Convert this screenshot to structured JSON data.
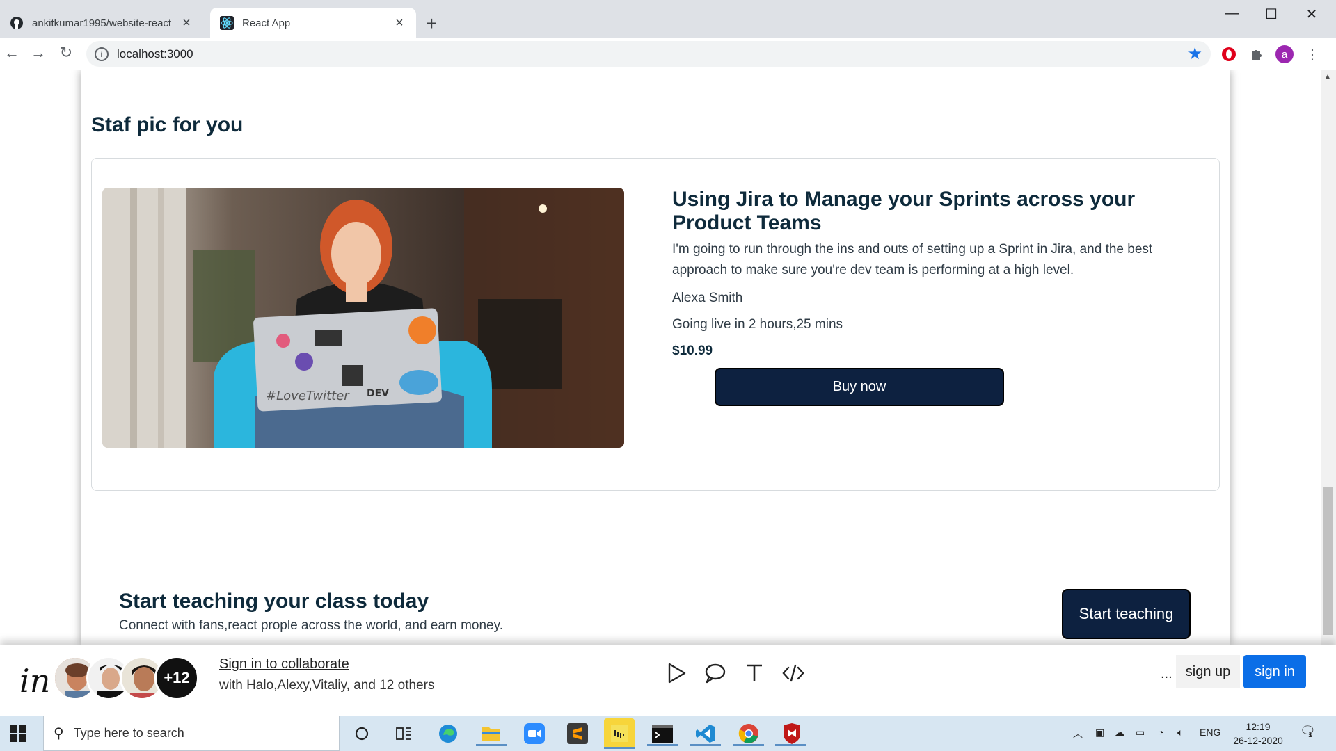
{
  "browser": {
    "tabs": [
      {
        "title": "ankitkumar1995/website-react",
        "active": false,
        "icon": "github-icon"
      },
      {
        "title": "React App",
        "active": true,
        "icon": "react-icon"
      }
    ],
    "url": "localhost:3000"
  },
  "page": {
    "section_title": "Staf pic for you",
    "card": {
      "title": "Using Jira to Manage your Sprints across your Product Teams",
      "description": "I'm going to run through the ins and outs of setting up a Sprint in Jira, and the best approach to make sure you're dev team is performing at a high level.",
      "author": "Alexa Smith",
      "live": "Going live in 2 hours,25 mins",
      "price": "$10.99",
      "buy_label": "Buy now"
    },
    "teach": {
      "title": "Start teaching your class today",
      "subtitle": "Connect with fans,react prople across the world, and earn money.",
      "button": "Start teaching"
    }
  },
  "collab": {
    "logo": "in",
    "extra_count": "+12",
    "sign_in_link": "Sign in to collaborate",
    "with_text": "with Halo,Alexy,Vitaliy, and 12 others",
    "more": "...",
    "sign_up": "sign up",
    "sign_in": "sign in"
  },
  "taskbar": {
    "search_placeholder": "Type here to search",
    "language": "ENG",
    "time": "12:19",
    "date": "26-12-2020",
    "notification_count": "1"
  },
  "colors": {
    "button_dark": "#0d2140",
    "heading": "#0e2a3b",
    "sign_in_blue": "#0b6ee7"
  }
}
